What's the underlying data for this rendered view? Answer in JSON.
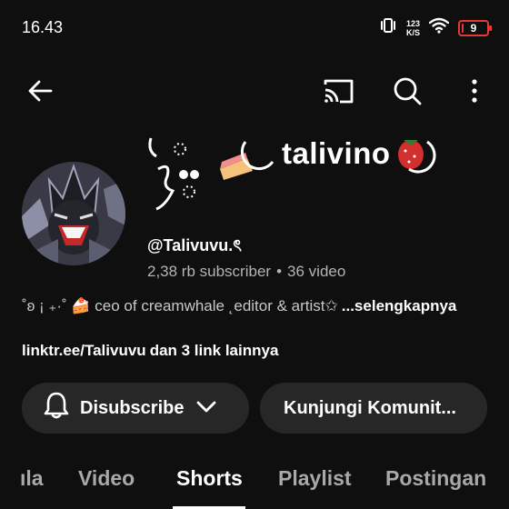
{
  "status_bar": {
    "time": "16.43",
    "net_speed_value": "123",
    "net_speed_unit": "K/S",
    "battery_level": 9,
    "battery_text": "9",
    "battery_color": "#e53935"
  },
  "app_bar": {
    "icons": [
      "back-arrow-icon",
      "cast-icon",
      "search-icon",
      "more-vert-icon"
    ]
  },
  "channel": {
    "name": "talivino",
    "handle": "@Talivuvu.ৎ",
    "subscribers": "2,38 rb subscriber",
    "separator": "•",
    "videos": "36 video",
    "description": "˚ʚ ¡ ₊·˚ 🍰 ceo of creamwhale ˛editor & artist✩",
    "description_more": "...selengkapnya",
    "link_url": "linktr.ee/Talivuvu",
    "link_more": "dan 3 link lainnya"
  },
  "actions": {
    "subscribe_label": "Disubscribe",
    "community_label": "Kunjungi Komunit..."
  },
  "tabs": [
    {
      "label": "ıla",
      "active": false
    },
    {
      "label": "Video",
      "active": false
    },
    {
      "label": "Shorts",
      "active": true
    },
    {
      "label": "Playlist",
      "active": false
    },
    {
      "label": "Postingan",
      "active": false
    }
  ],
  "colors": {
    "background": "#0f0f0f",
    "pill": "#272727",
    "secondary_text": "#b4b4b4"
  }
}
